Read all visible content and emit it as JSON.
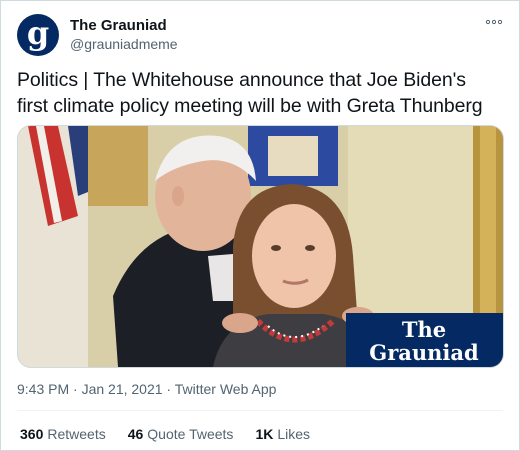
{
  "account": {
    "avatar_letter": "g",
    "name": "The Grauniad",
    "handle": "@grauniadmeme",
    "avatar_color": "#052962"
  },
  "tweet": {
    "lines": [
      "Politics | The Whitehouse announce that Joe Biden's",
      "first climate policy meeting will be with Greta Thunberg"
    ]
  },
  "media": {
    "logo_line1": "The",
    "logo_line2": "Grauniad",
    "logo_bg": "#052962"
  },
  "meta": {
    "timestamp": "9:43 PM · Jan 21, 2021 · Twitter Web App"
  },
  "stats": [
    {
      "count": "360",
      "label": "Retweets"
    },
    {
      "count": "46",
      "label": "Quote Tweets"
    },
    {
      "count": "1K",
      "label": "Likes"
    }
  ],
  "icons": {
    "more": "more-icon"
  }
}
